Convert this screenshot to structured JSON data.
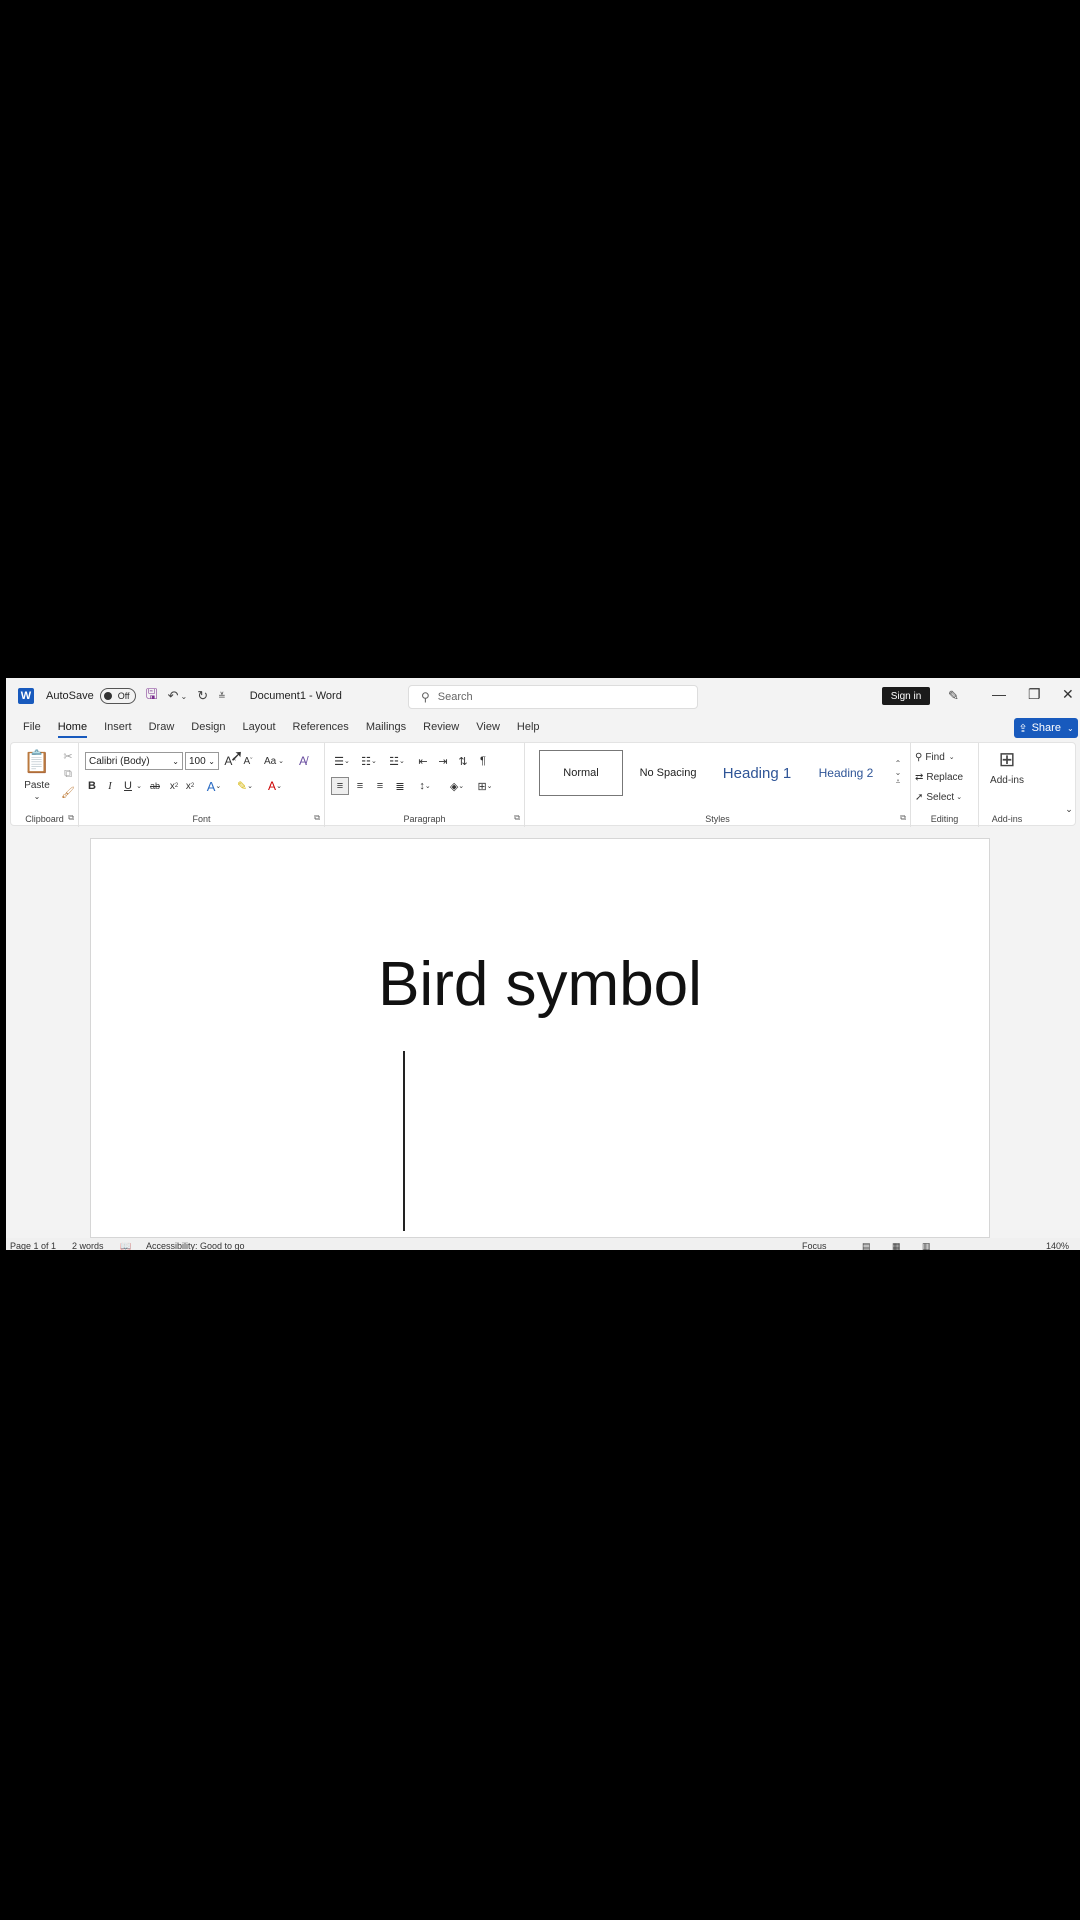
{
  "app": {
    "logo": "W",
    "autosave_label": "AutoSave",
    "autosave_state": "Off",
    "doc_title": "Document1  -  Word",
    "search_placeholder": "Search",
    "signin_label": "Sign in",
    "share_label": "Share"
  },
  "tabs": [
    "File",
    "Home",
    "Insert",
    "Draw",
    "Design",
    "Layout",
    "References",
    "Mailings",
    "Review",
    "View",
    "Help"
  ],
  "ribbon": {
    "clipboard": {
      "paste_label": "Paste",
      "group_label": "Clipboard"
    },
    "font": {
      "font_name": "Calibri (Body)",
      "font_size": "100",
      "change_case": "Aa",
      "group_label": "Font"
    },
    "paragraph": {
      "group_label": "Paragraph"
    },
    "styles": {
      "items": [
        "Normal",
        "No Spacing",
        "Heading 1",
        "Heading 2"
      ],
      "group_label": "Styles"
    },
    "editing": {
      "find": "Find",
      "replace": "Replace",
      "select": "Select",
      "group_label": "Editing"
    },
    "addins": {
      "label": "Add-ins",
      "group_label": "Add-ins"
    }
  },
  "document": {
    "heading_text": "Bird symbol"
  },
  "status": {
    "page": "Page 1 of 1",
    "words": "2 words",
    "accessibility": "Accessibility: Good to go",
    "focus": "Focus",
    "zoom": "140%"
  },
  "icons": {
    "save": "save-icon",
    "undo": "undo-icon",
    "redo": "redo-icon",
    "search": "search-icon",
    "pen": "pen-icon",
    "minimize": "minimize-icon",
    "restore": "restore-icon",
    "close": "close-icon"
  },
  "colors": {
    "accent": "#185abd",
    "save_icon": "#7b2f8f"
  }
}
